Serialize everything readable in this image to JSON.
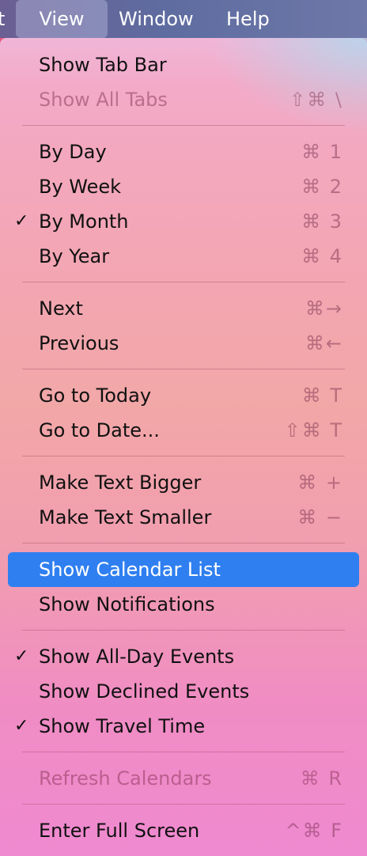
{
  "menubar": {
    "edge_label": "t",
    "view": "View",
    "window": "Window",
    "help": "Help"
  },
  "menu": {
    "show_tab_bar": {
      "label": "Show Tab Bar"
    },
    "show_all_tabs": {
      "label": "Show All Tabs",
      "shortcut": "⇧⌘ \\"
    },
    "by_day": {
      "label": "By Day",
      "shortcut": "⌘ 1"
    },
    "by_week": {
      "label": "By Week",
      "shortcut": "⌘ 2"
    },
    "by_month": {
      "label": "By Month",
      "shortcut": "⌘ 3",
      "check": "✓"
    },
    "by_year": {
      "label": "By Year",
      "shortcut": "⌘ 4"
    },
    "next": {
      "label": "Next",
      "shortcut": "⌘→"
    },
    "previous": {
      "label": "Previous",
      "shortcut": "⌘←"
    },
    "go_to_today": {
      "label": "Go to Today",
      "shortcut": "⌘ T"
    },
    "go_to_date": {
      "label": "Go to Date...",
      "shortcut": "⇧⌘ T"
    },
    "make_text_bigger": {
      "label": "Make Text Bigger",
      "shortcut": "⌘ +"
    },
    "make_text_smaller": {
      "label": "Make Text Smaller",
      "shortcut": "⌘ −"
    },
    "show_calendar_list": {
      "label": "Show Calendar List"
    },
    "show_notifications": {
      "label": "Show Notifications"
    },
    "show_all_day_events": {
      "label": "Show All-Day Events",
      "check": "✓"
    },
    "show_declined_events": {
      "label": "Show Declined Events"
    },
    "show_travel_time": {
      "label": "Show Travel Time",
      "check": "✓"
    },
    "refresh_calendars": {
      "label": "Refresh Calendars",
      "shortcut": "⌘ R"
    },
    "enter_full_screen": {
      "label": "Enter Full Screen",
      "shortcut": "^⌘ F"
    }
  },
  "colors": {
    "highlight": "#2f7ff0",
    "menubar": "#5e6ca0"
  }
}
